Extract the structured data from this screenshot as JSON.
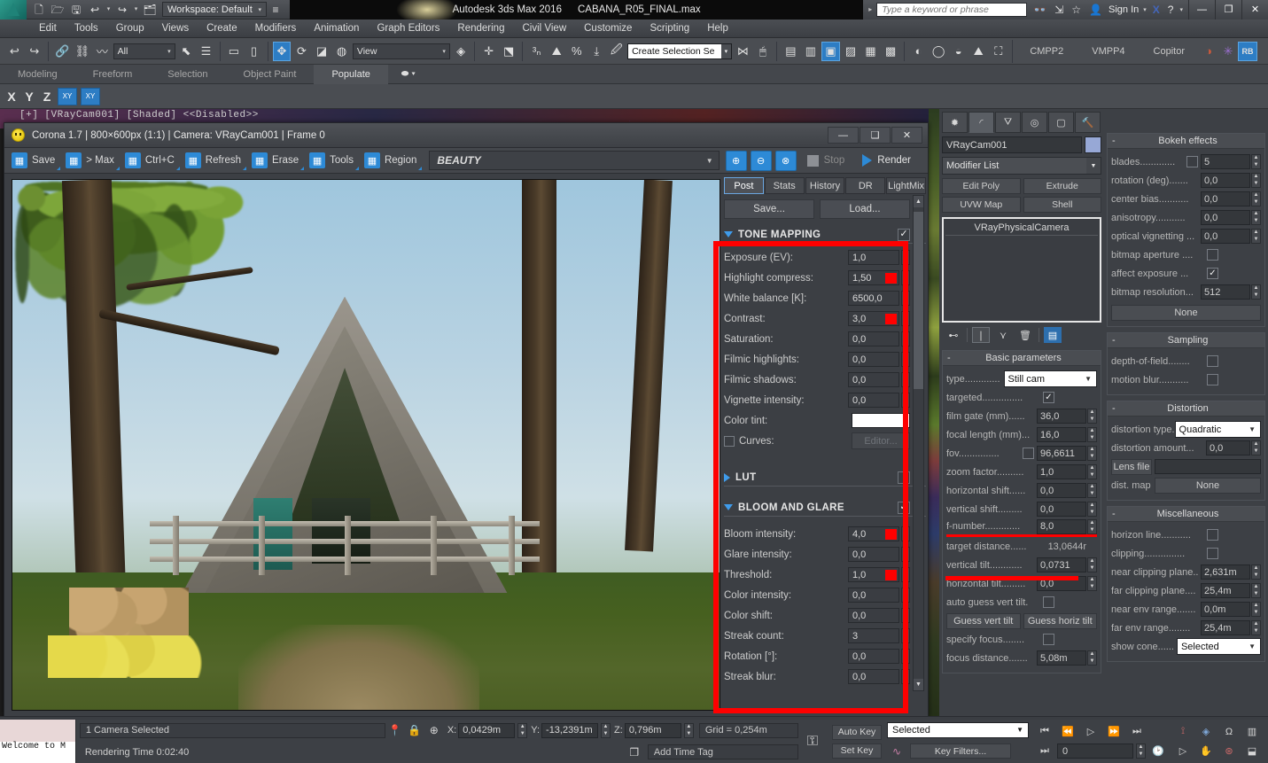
{
  "titlebar": {
    "logo": "MAX",
    "quick_access": [
      "new-icon",
      "open-icon",
      "save-icon",
      "undo-icon",
      "redo-icon",
      "project-folder-icon"
    ],
    "workspace_label": "Workspace: Default",
    "app_title": "Autodesk 3ds Max 2016",
    "file_name": "CABANA_R05_FINAL.max",
    "search_placeholder": "Type a keyword or phrase",
    "sign_in": "Sign In",
    "window_buttons": {
      "minimize": "—",
      "restore": "❐",
      "close": "✕"
    }
  },
  "menubar": {
    "items": [
      "Edit",
      "Tools",
      "Group",
      "Views",
      "Create",
      "Modifiers",
      "Animation",
      "Graph Editors",
      "Rendering",
      "Civil View",
      "Customize",
      "Scripting",
      "Help"
    ]
  },
  "maintoolbar": {
    "selection_filter": "All",
    "ref_coord_system": "View",
    "named_selection_set": "Create Selection Se",
    "plugins": [
      "CMPP2",
      "VMPP4",
      "Copitor"
    ],
    "rb_badge": "RB"
  },
  "ribbon": {
    "tabs": [
      "Modeling",
      "Freeform",
      "Selection",
      "Object Paint",
      "Populate"
    ],
    "active_tab": "Populate"
  },
  "axisbar": {
    "axes": [
      "X",
      "Y",
      "Z"
    ],
    "plane_buttons": [
      "XY",
      "XY"
    ]
  },
  "viewport": {
    "label": "[+] [VRayCam001] [Shaded] <<Disabled>>"
  },
  "vfb": {
    "title": "Corona 1.7 | 800×600px (1:1) | Camera: VRayCam001 | Frame 0",
    "toolbar_buttons": [
      {
        "label": "Save",
        "icon": "floppy-icon"
      },
      {
        "label": "> Max",
        "icon": "to-max-icon"
      },
      {
        "label": "Ctrl+C",
        "icon": "copy-icon"
      },
      {
        "label": "Refresh",
        "icon": "refresh-icon"
      },
      {
        "label": "Erase",
        "icon": "erase-icon"
      },
      {
        "label": "Tools",
        "icon": "gear-icon"
      },
      {
        "label": "Region",
        "icon": "region-icon"
      }
    ],
    "pass_combo": "BEAUTY",
    "zoom_buttons": [
      "zoom-in-icon",
      "zoom-out-icon",
      "zoom-reset-icon"
    ],
    "stop_label": "Stop",
    "render_label": "Render",
    "window_buttons": {
      "minimize": "—",
      "restore": "❑",
      "close": "✕"
    }
  },
  "post": {
    "tabs": [
      "Post",
      "Stats",
      "History",
      "DR",
      "LightMix"
    ],
    "active_tab": "Post",
    "save_label": "Save...",
    "load_label": "Load...",
    "tone_mapping": {
      "title": "TONE MAPPING",
      "enabled": true,
      "rows": [
        {
          "label": "Exposure (EV):",
          "value": "1,0",
          "marked": false
        },
        {
          "label": "Highlight compress:",
          "value": "1,50",
          "marked": true
        },
        {
          "label": "White balance [K]:",
          "value": "6500,0",
          "marked": false
        },
        {
          "label": "Contrast:",
          "value": "3,0",
          "marked": true
        },
        {
          "label": "Saturation:",
          "value": "0,0",
          "marked": false
        },
        {
          "label": "Filmic highlights:",
          "value": "0,0",
          "marked": false
        },
        {
          "label": "Filmic shadows:",
          "value": "0,0",
          "marked": false
        },
        {
          "label": "Vignette intensity:",
          "value": "0,0",
          "marked": false
        }
      ],
      "color_tint_label": "Color tint:",
      "color_tint_value": "#ffffff",
      "curves_label": "Curves:",
      "curves_checked": false,
      "curves_editor_label": "Editor..."
    },
    "lut": {
      "title": "LUT",
      "enabled": false
    },
    "bloom_glare": {
      "title": "BLOOM AND GLARE",
      "enabled": true,
      "rows": [
        {
          "label": "Bloom intensity:",
          "value": "4,0",
          "marked": true
        },
        {
          "label": "Glare intensity:",
          "value": "0,0",
          "marked": false
        },
        {
          "label": "Threshold:",
          "value": "1,0",
          "marked": true
        },
        {
          "label": "Color intensity:",
          "value": "0,0",
          "marked": false
        },
        {
          "label": "Color shift:",
          "value": "0,0",
          "marked": false
        },
        {
          "label": "Streak count:",
          "value": "3",
          "marked": false
        },
        {
          "label": "Rotation [°]:",
          "value": "0,0",
          "marked": false
        },
        {
          "label": "Streak blur:",
          "value": "0,0",
          "marked": false
        }
      ]
    },
    "highlight_color": "#ff0000"
  },
  "command_panel": {
    "tabs": [
      "create-icon",
      "modify-icon",
      "hierarchy-icon",
      "motion-icon",
      "display-icon",
      "utilities-icon"
    ],
    "active_tab_index": 1,
    "object_name": "VRayCam001",
    "object_color": "#97a8d6",
    "modifier_list_label": "Modifier List",
    "modifier_buttons": [
      "Edit Poly",
      "Extrude",
      "UVW Map",
      "Shell"
    ],
    "stack": [
      "VRayPhysicalCamera"
    ],
    "stack_tools": [
      "pin-stack-icon",
      "show-end-result-icon",
      "make-unique-icon",
      "remove-modifier-icon",
      "configure-sets-icon"
    ],
    "basic_parameters": {
      "title": "Basic parameters",
      "type_label": "type.............",
      "type_value": "Still cam",
      "rows": [
        {
          "label": "targeted...............",
          "type": "checkbox",
          "checked": true
        },
        {
          "label": "film gate (mm)......",
          "type": "field",
          "value": "36,0"
        },
        {
          "label": "focal length (mm)...",
          "type": "field",
          "value": "16,0"
        },
        {
          "label": "fov...............",
          "type": "check-field",
          "checked": false,
          "value": "96,6611"
        },
        {
          "label": "zoom factor..........",
          "type": "field",
          "value": "1,0"
        },
        {
          "label": "horizontal shift......",
          "type": "field",
          "value": "0,0"
        },
        {
          "label": "vertical shift.........",
          "type": "field",
          "value": "0,0"
        },
        {
          "label": "f-number.............",
          "type": "field",
          "value": "8,0",
          "underlined": true
        },
        {
          "label": "target distance......",
          "type": "readonly",
          "value": "13,0644r"
        },
        {
          "label": "vertical tilt............",
          "type": "field",
          "value": "0,0731"
        },
        {
          "label": "horizontal tilt.........",
          "type": "field",
          "value": "0,0"
        },
        {
          "label": "auto guess vert tilt.",
          "type": "checkbox",
          "checked": false
        }
      ],
      "guess_vert_label": "Guess vert tilt",
      "guess_horiz_label": "Guess horiz tilt",
      "specify_focus_label": "specify focus........",
      "specify_focus_checked": false,
      "focus_distance_label": "focus distance.......",
      "focus_distance_value": "5,08m"
    },
    "bokeh_effects": {
      "title": "Bokeh effects",
      "rows": [
        {
          "label": "blades.............",
          "type": "check-field",
          "checked": false,
          "value": "5"
        },
        {
          "label": "rotation (deg).......",
          "type": "field",
          "value": "0,0"
        },
        {
          "label": "center bias...........",
          "type": "field",
          "value": "0,0"
        },
        {
          "label": "anisotropy...........",
          "type": "field",
          "value": "0,0"
        },
        {
          "label": "optical vignetting ...",
          "type": "field",
          "value": "0,0"
        },
        {
          "label": "bitmap aperture ....",
          "type": "checkbox",
          "checked": false
        },
        {
          "label": "affect exposure ...",
          "type": "checkbox",
          "checked": true
        },
        {
          "label": "bitmap resolution...",
          "type": "field",
          "value": "512"
        }
      ],
      "none_button": "None"
    },
    "sampling": {
      "title": "Sampling",
      "rows": [
        {
          "label": "depth-of-field........",
          "type": "checkbox",
          "checked": false
        },
        {
          "label": "motion blur...........",
          "type": "checkbox",
          "checked": false
        }
      ]
    },
    "distortion": {
      "title": "Distortion",
      "type_label": "distortion type.",
      "type_value": "Quadratic",
      "amount_label": "distortion amount...",
      "amount_value": "0,0",
      "lens_file_label": "Lens file",
      "lens_file_value": "",
      "dist_map_label": "dist. map",
      "dist_map_value": "None"
    },
    "miscellaneous": {
      "title": "Miscellaneous",
      "rows": [
        {
          "label": "horizon line...........",
          "type": "checkbox",
          "checked": false
        },
        {
          "label": "clipping...............",
          "type": "checkbox",
          "checked": false
        },
        {
          "label": "near clipping plane..",
          "type": "field",
          "value": "2,631m"
        },
        {
          "label": "far clipping plane....",
          "type": "field",
          "value": "25,4m"
        },
        {
          "label": "near env range.......",
          "type": "field",
          "value": "0,0m"
        },
        {
          "label": "far env range........",
          "type": "field",
          "value": "25,4m"
        }
      ],
      "show_cone_label": "show cone......",
      "show_cone_value": "Selected"
    }
  },
  "statusbar": {
    "mini_listener": "Welcome to M",
    "selection_info": "1 Camera Selected",
    "render_time": "Rendering Time  0:02:40",
    "coords": [
      {
        "axis": "X:",
        "value": "0,0429m"
      },
      {
        "axis": "Y:",
        "value": "-13,2391m"
      },
      {
        "axis": "Z:",
        "value": "0,796m"
      }
    ],
    "grid_label": "Grid = 0,254m",
    "add_time_tag": "Add Time Tag",
    "auto_key": "Auto Key",
    "set_key": "Set Key",
    "anim_mode": "Selected",
    "key_filters": "Key Filters...",
    "frame_value": "0"
  }
}
